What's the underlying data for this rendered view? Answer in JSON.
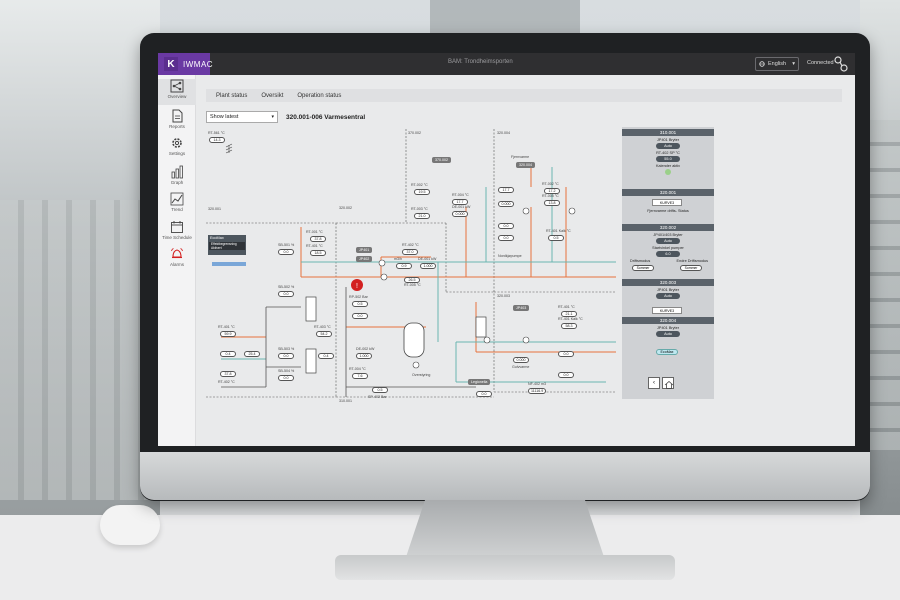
{
  "app": {
    "brand_mark": "K",
    "brand_name": "IWMAC",
    "window_title": "BAM: Trondheimsporten",
    "language": "English",
    "connection_status": "Connected"
  },
  "sidebar": {
    "items": [
      {
        "label": "Overview",
        "icon": "network-icon"
      },
      {
        "label": "Reports",
        "icon": "document-icon"
      },
      {
        "label": "Settings",
        "icon": "gear-icon"
      },
      {
        "label": "Graph",
        "icon": "bar-chart-icon"
      },
      {
        "label": "Trend",
        "icon": "trend-icon"
      },
      {
        "label": "Time Schedule",
        "icon": "calendar-icon"
      },
      {
        "label": "Alarms",
        "icon": "alarm-icon"
      }
    ]
  },
  "tabs": [
    "Plant status",
    "Oversikt",
    "Operation status"
  ],
  "view_select": "Show latest",
  "page_title": "320.001-006 Varmesentral",
  "diagram": {
    "sections": [
      "370.002",
      "320.004",
      "320.002",
      "320.001",
      "320.003",
      "310.001"
    ],
    "ecomax_title": "EcoMax",
    "ecomax_text": "Effektbegrensning\nAktivert",
    "pumps": [
      "JP401",
      "JP402",
      "JP403"
    ],
    "readings": [
      {
        "tag": "RT-561 °C",
        "value": "14.3"
      },
      {
        "tag": "RT-401 °C",
        "value": "59.9"
      },
      {
        "tag": "RT-402 °C",
        "value": "37.0"
      },
      {
        "tag": "RT-003 °C",
        "value": "21.0"
      },
      {
        "tag": "RT-004 °C",
        "value": "17.7"
      },
      {
        "tag": "DE-001 kW",
        "value": "0.000"
      },
      {
        "tag": "RT-401 Kalk °C",
        "value": "37.0"
      },
      {
        "tag": "RT-401 Kalk °C",
        "value": "21.1"
      },
      {
        "tag": "SB-501 %",
        "value": "0.0"
      },
      {
        "tag": "SB-502 %",
        "value": "0.0"
      },
      {
        "tag": "SB-503 %",
        "value": "25.4"
      },
      {
        "tag": "SB-504 %",
        "value": "0.0"
      },
      {
        "tag": "RT-005 °C",
        "value": "26.5"
      },
      {
        "tag": "RP-502 Bar",
        "value": "0.5"
      },
      {
        "tag": "RT-001 °C",
        "value": "37.8"
      },
      {
        "tag": "RT-401 °C",
        "value": "18.5"
      },
      {
        "tag": "DE-001 kW",
        "value": "1.000"
      },
      {
        "tag": "m3/h",
        "value": "0.9"
      },
      {
        "tag": "RT-403 °C",
        "value": "54.2"
      },
      {
        "tag": "m3/h",
        "value": "0.4"
      },
      {
        "tag": "DE-002 kW",
        "value": "1.000"
      },
      {
        "tag": "RT-004 °C",
        "value": "7.6"
      },
      {
        "tag": "SP-402 Bar",
        "value": "0.5"
      },
      {
        "tag": "RT-002 °C",
        "value": "19.5"
      },
      {
        "tag": "RT-005 °C",
        "value": "13.8"
      },
      {
        "tag": "RT-002 °C",
        "value": "17.2"
      },
      {
        "tag": "RT-401 °C",
        "value": "58.3"
      },
      {
        "tag": "RT-402 °C",
        "value": "0.000"
      },
      {
        "tag": "NF-402 m3",
        "value": "11116.9"
      }
    ],
    "equipment_labels": [
      "Overstyring",
      "Legionella",
      "Gulvvarme",
      "Nordkjøpumpe",
      "Fjernvarme"
    ]
  },
  "panel": {
    "sections": [
      {
        "id": "310.001",
        "lines": [
          "JP401 Bryter",
          "Auto",
          "RT-402 SP °C",
          "55.0",
          "Kalender aktiv"
        ]
      },
      {
        "id": "320.001",
        "lines": [
          "KURVE3",
          "Fjernvarme drifts- Status"
        ]
      },
      {
        "id": "320.002",
        "lines": [
          "JP401/403 Bryter",
          "Auto",
          "Startvinkel pumper",
          "6.0",
          "Driftsmodus",
          "Endre Driftsmodus",
          "Sommer",
          "Sommer"
        ]
      },
      {
        "id": "320.003",
        "lines": [
          "JP401 Bryter",
          "Auto",
          "KURVE3"
        ]
      },
      {
        "id": "320.004",
        "lines": [
          "JP401 Bryter",
          "Auto",
          "EcoMax"
        ]
      }
    ]
  },
  "colors": {
    "brand_purple": "#6a39a3",
    "supply_line": "#e8733c",
    "return_line": "#6ab5b0",
    "alarm_red": "#d32020",
    "panel_header": "#5a626a"
  }
}
